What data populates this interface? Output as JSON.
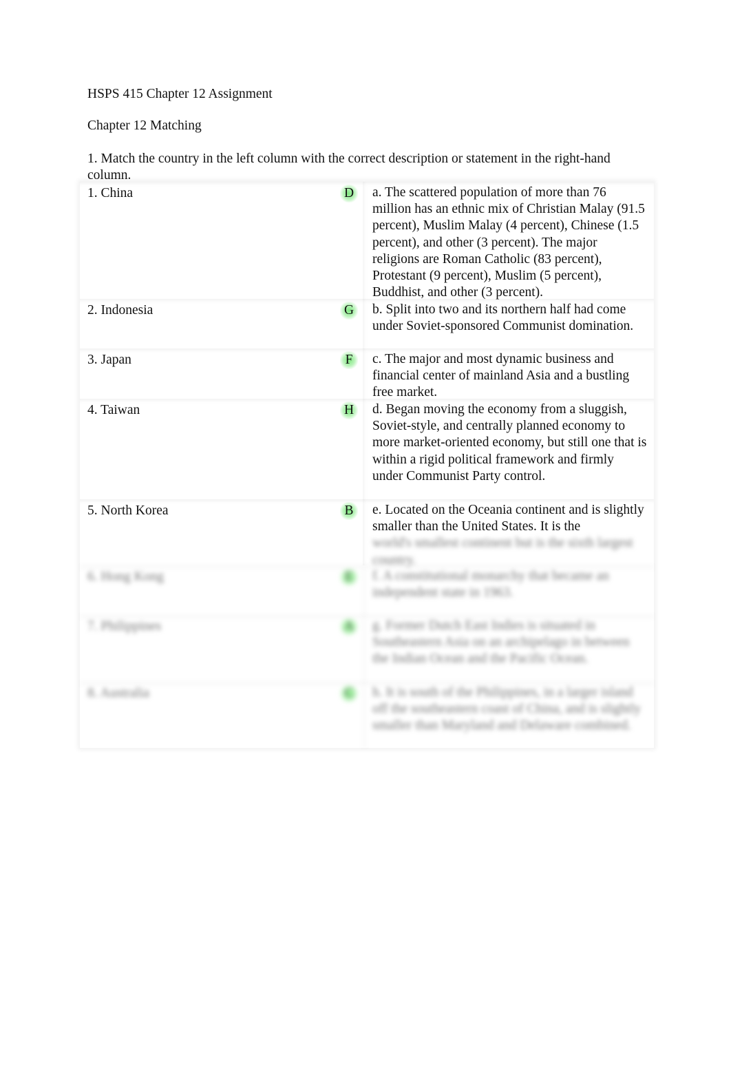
{
  "document": {
    "title": "HSPS 415 Chapter 12 Assignment",
    "section_title": "Chapter 12 Matching",
    "instructions": "1. Match the country in the left column with the correct description or statement in the right-hand column."
  },
  "table": {
    "rows": [
      {
        "country": "1. China",
        "answer": "D",
        "description": "a. The scattered population of more than 76 million has an ethnic mix of Christian Malay (91.5 percent), Muslim Malay (4 percent), Chinese (1.5 percent), and other (3 percent). The major religions are Roman Catholic (83 percent), Protestant (9 percent), Muslim (5 percent), Buddhist, and other (3 percent).",
        "blurred": false
      },
      {
        "country": "2. Indonesia",
        "answer": "G",
        "description": "b. Split into two and its northern half had come under Soviet-sponsored Communist domination.",
        "blurred": false
      },
      {
        "country": "3. Japan",
        "answer": "F",
        "description": "c. The major and most dynamic business and financial center of mainland Asia and a bustling free market.",
        "blurred": false
      },
      {
        "country": "4. Taiwan",
        "answer": "H",
        "description": "d. Began moving the economy from a sluggish, Soviet-style, and centrally planned economy to more market-oriented economy, but still one that is within a rigid political framework and firmly under Communist Party control.",
        "blurred": false
      },
      {
        "country": "5. North Korea",
        "answer": "B",
        "description": "e. Located on the Oceania continent and is slightly smaller than the United States. It is the",
        "description_blurred_tail": "world's smallest continent but is the sixth largest country.",
        "blurred": false
      },
      {
        "country": "6. Hong Kong",
        "answer": "E",
        "description": "f. A constitutional monarchy that became an independent state in 1963.",
        "blurred": true
      },
      {
        "country": "7. Philippines",
        "answer": "A",
        "description": "g. Former Dutch East Indies is situated in Southeastern Asia on an archipelago in between the Indian Ocean and the Pacific Ocean.",
        "blurred": true
      },
      {
        "country": "8. Australia",
        "answer": "C",
        "description": "h. It is south of the Philippines, in a larger island off the southeastern coast of China, and is slightly smaller than Maryland and Delaware combined.",
        "blurred": true
      }
    ]
  },
  "colors": {
    "answer_highlight": "#7ee67e",
    "text": "#111111"
  }
}
